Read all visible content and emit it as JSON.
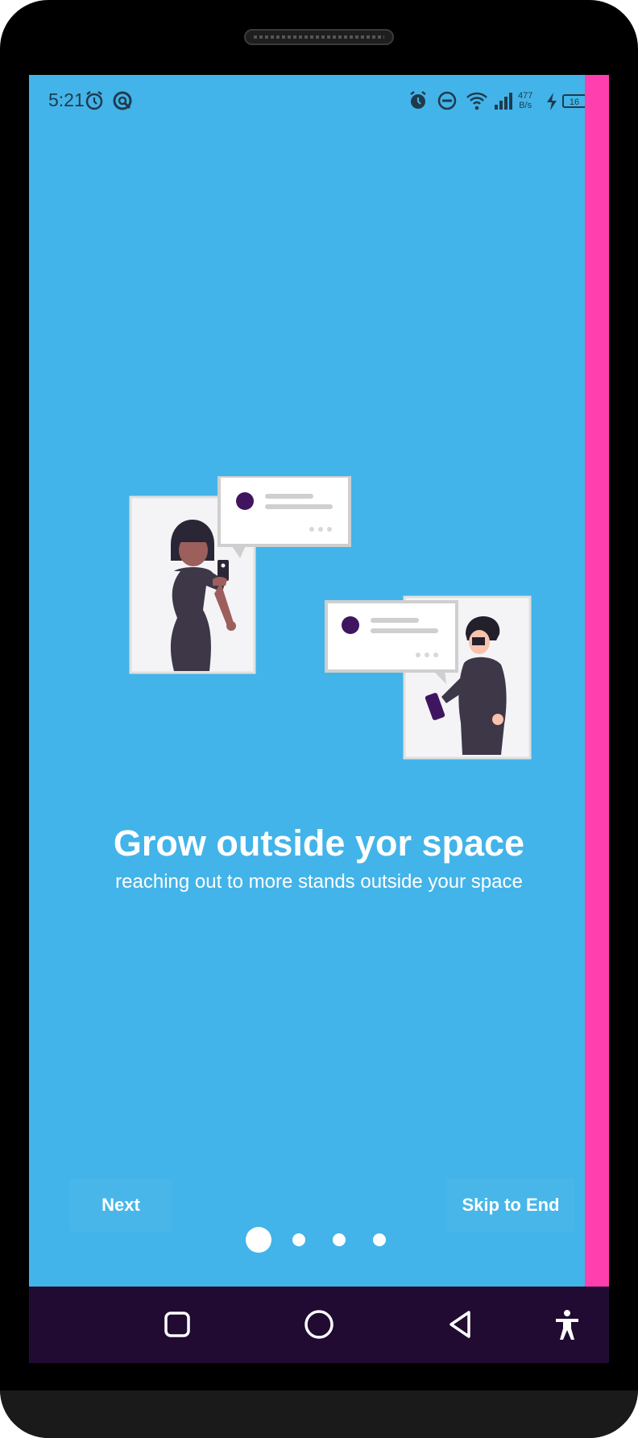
{
  "status_bar": {
    "time": "5:21",
    "net_speed_value": "477",
    "net_speed_unit": "B/s",
    "battery_level": "16"
  },
  "onboarding": {
    "title": "Grow outside yor space",
    "subtitle": "reaching out to more stands outside your space",
    "next_label": "Next",
    "skip_label": "Skip to End",
    "page_count": 4,
    "current_page": 1
  },
  "icons": {
    "status_left": [
      "alarm-icon",
      "sync-icon"
    ],
    "status_right": [
      "alarm-icon",
      "do-not-disturb-icon",
      "wifi-icon",
      "signal-icon",
      "charging-icon",
      "battery-icon"
    ],
    "nav": [
      "recent-apps-icon",
      "home-icon",
      "back-icon",
      "accessibility-icon"
    ]
  },
  "colors": {
    "background": "#42b4e9",
    "accent_bar": "#ff3fae",
    "nav_bar": "#210b32",
    "text": "#ffffff"
  }
}
